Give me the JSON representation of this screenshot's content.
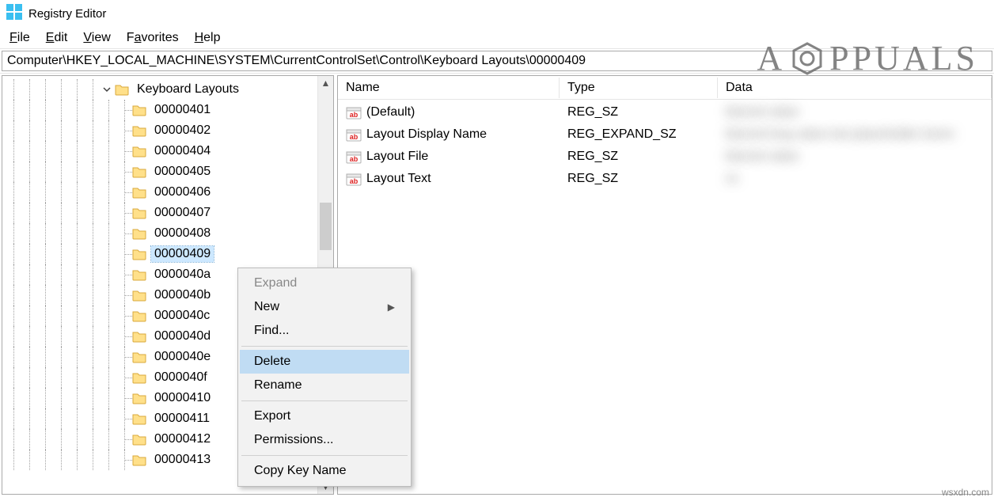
{
  "window": {
    "title": "Registry Editor"
  },
  "menubar": {
    "file": "File",
    "edit": "Edit",
    "view": "View",
    "favorites": "Favorites",
    "help": "Help"
  },
  "addressbar": {
    "path": "Computer\\HKEY_LOCAL_MACHINE\\SYSTEM\\CurrentControlSet\\Control\\Keyboard Layouts\\00000409"
  },
  "tree": {
    "parent_label": "Keyboard Layouts",
    "selected_key": "00000409",
    "items": [
      "00000401",
      "00000402",
      "00000404",
      "00000405",
      "00000406",
      "00000407",
      "00000408",
      "00000409",
      "0000040a",
      "0000040b",
      "0000040c",
      "0000040d",
      "0000040e",
      "0000040f",
      "00000410",
      "00000411",
      "00000412",
      "00000413"
    ]
  },
  "list": {
    "headers": {
      "name": "Name",
      "type": "Type",
      "data": "Data"
    },
    "rows": [
      {
        "name": "(Default)",
        "type": "REG_SZ",
        "data": "blurred value"
      },
      {
        "name": "Layout Display Name",
        "type": "REG_EXPAND_SZ",
        "data": "blurred long value text placeholder lorem"
      },
      {
        "name": "Layout File",
        "type": "REG_SZ",
        "data": "blurred value"
      },
      {
        "name": "Layout Text",
        "type": "REG_SZ",
        "data": "xx"
      }
    ]
  },
  "context_menu": {
    "expand": "Expand",
    "new": "New",
    "find": "Find...",
    "delete": "Delete",
    "rename": "Rename",
    "export": "Export",
    "permissions": "Permissions...",
    "copy_key_name": "Copy Key Name"
  },
  "watermark": {
    "text": "PPUALS"
  },
  "source": {
    "text": "wsxdn.com"
  }
}
